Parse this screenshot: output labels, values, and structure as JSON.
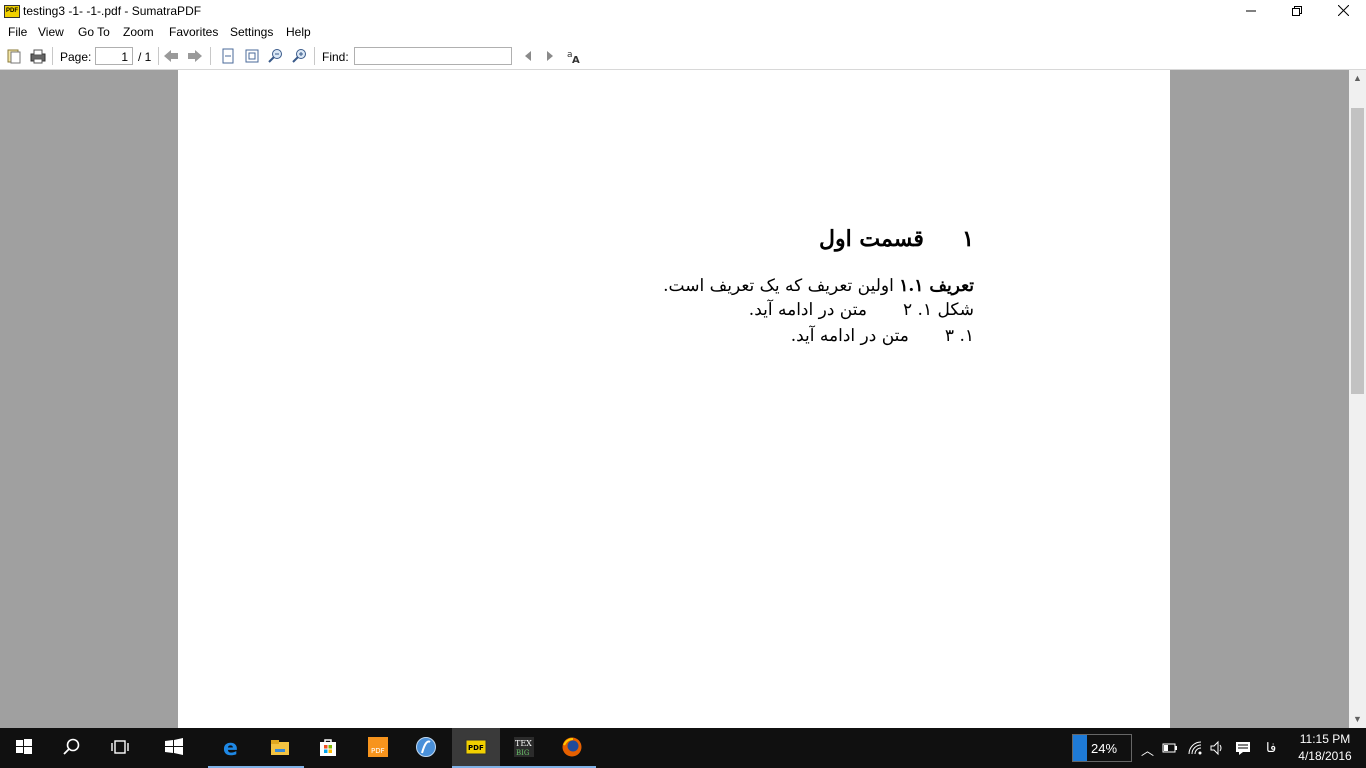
{
  "window": {
    "title": "testing3 -1- -1-.pdf - SumatraPDF",
    "logo_text": "PDF",
    "minimize_icon": "minimize-icon",
    "maximize_icon": "restore-icon",
    "close_icon": "close-icon"
  },
  "menu": [
    "File",
    "View",
    "Go To",
    "Zoom",
    "Favorites",
    "Settings",
    "Help"
  ],
  "toolbar": {
    "page_label": "Page:",
    "page_value": "1",
    "page_total": "/ 1",
    "find_label": "Find:",
    "find_value": ""
  },
  "document": {
    "heading": "۱     قسمت اول",
    "line1_bold": "تعریف ۱.۱",
    "line1_rest": " اولین تعریف که یک تعریف است.",
    "line2_label": "شکل ۱. ۲",
    "line2_text": "متن در ادامه آید.",
    "line3_label": "۱. ۳",
    "line3_text": "متن در ادامه آید."
  },
  "taskbar": {
    "apps": [
      {
        "name": "start-icon"
      },
      {
        "name": "search-icon"
      },
      {
        "name": "task-view-icon"
      },
      {
        "name": "windows-store-tile-icon"
      },
      {
        "name": "edge-icon"
      },
      {
        "name": "file-explorer-icon"
      },
      {
        "name": "store-icon"
      },
      {
        "name": "pdf-app-icon"
      },
      {
        "name": "browser-icon"
      },
      {
        "name": "sumatra-icon"
      },
      {
        "name": "tex-icon"
      },
      {
        "name": "firefox-icon"
      }
    ],
    "battery_percent": "24%",
    "battery_level": 0.24,
    "lang": "فا",
    "time": "11:15 PM",
    "date": "4/18/2016"
  },
  "colors": {
    "accent": "#1e7ad6",
    "taskbar": "#101010",
    "doc_background": "#a0a0a0"
  }
}
